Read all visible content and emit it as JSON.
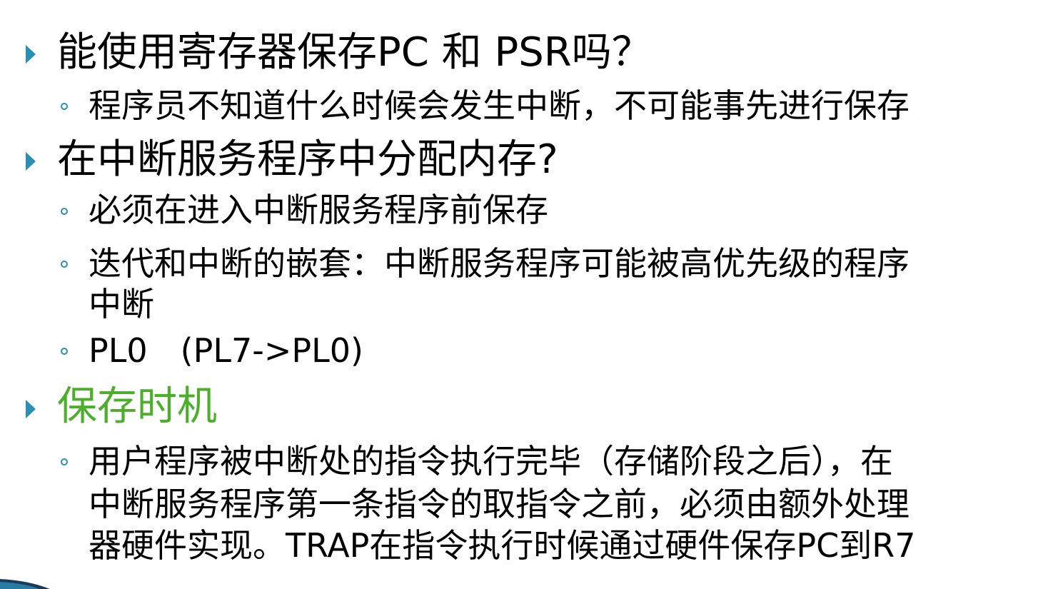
{
  "slide": {
    "q1": {
      "title": "能使用寄存器保存PC 和 PSR吗？",
      "sub1": "程序员不知道什么时候会发生中断，不可能事先进行保存"
    },
    "q2": {
      "title": "在中断服务程序中分配内存?",
      "sub1": "必须在进入中断服务程序前保存",
      "sub2_line1": "迭代和中断的嵌套：中断服务程序可能被高优先级的程序",
      "sub2_line2": "中断",
      "sub3": "PL0　(PL7->PL0)"
    },
    "q3": {
      "title": "保存时机",
      "sub1_line1": "用户程序被中断处的指令执行完毕（存储阶段之后），在",
      "sub1_line2": "中断服务程序第一条指令的取指令之前，必须由额外处理",
      "sub1_line3": "器硬件实现。TRAP在指令执行时候通过硬件保存PC到R7"
    },
    "colors": {
      "bullet": "#2a8fb0",
      "highlight": "#4caf2a",
      "text": "#000000"
    },
    "icons": {
      "level1_bullet": "triangle-bullet-icon",
      "level2_bullet": "circle-bullet-icon"
    }
  }
}
